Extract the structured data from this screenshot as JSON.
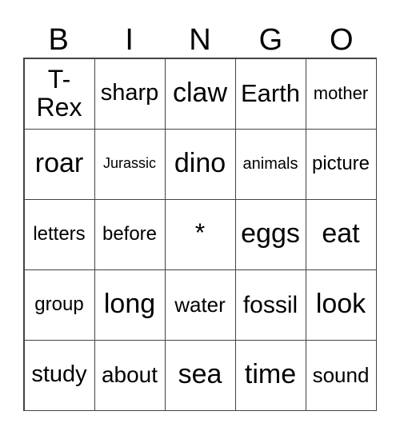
{
  "header": [
    "B",
    "I",
    "N",
    "G",
    "O"
  ],
  "cells": [
    [
      "T-Rex",
      "sharp",
      "claw",
      "Earth",
      "mother"
    ],
    [
      "roar",
      "Jurassic",
      "dino",
      "animals",
      "picture"
    ],
    [
      "letters",
      "before",
      "*",
      "eggs",
      "eat"
    ],
    [
      "group",
      "long",
      "water",
      "fossil",
      "look"
    ],
    [
      "study",
      "about",
      "sea",
      "time",
      "sound"
    ]
  ]
}
